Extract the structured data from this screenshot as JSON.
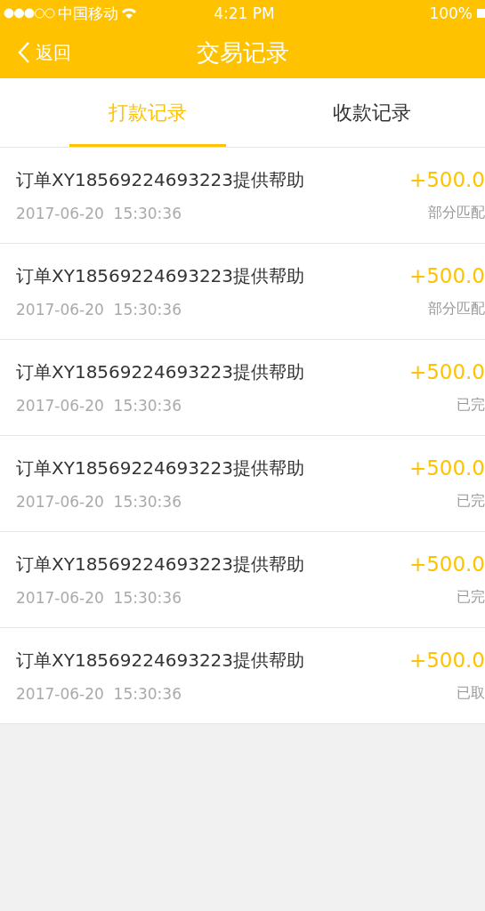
{
  "status_bar": {
    "carrier": "中国移动",
    "time": "4:21 PM",
    "battery": "100%"
  },
  "nav": {
    "back": "返回",
    "title": "交易记录"
  },
  "tabs": [
    {
      "label": "打款记录",
      "selected": true
    },
    {
      "label": "收款记录",
      "selected": false
    }
  ],
  "records": [
    {
      "title": "订单XY18569224693223提供帮助",
      "time": "2017-06-20  15:30:36",
      "amount": "+500.0",
      "status": "部分匹配"
    },
    {
      "title": "订单XY18569224693223提供帮助",
      "time": "2017-06-20  15:30:36",
      "amount": "+500.0",
      "status": "部分匹配"
    },
    {
      "title": "订单XY18569224693223提供帮助",
      "time": "2017-06-20  15:30:36",
      "amount": "+500.0",
      "status": "已完"
    },
    {
      "title": "订单XY18569224693223提供帮助",
      "time": "2017-06-20  15:30:36",
      "amount": "+500.0",
      "status": "已完"
    },
    {
      "title": "订单XY18569224693223提供帮助",
      "time": "2017-06-20  15:30:36",
      "amount": "+500.0",
      "status": "已完"
    },
    {
      "title": "订单XY18569224693223提供帮助",
      "time": "2017-06-20  15:30:36",
      "amount": "+500.0",
      "status": "已取"
    }
  ]
}
